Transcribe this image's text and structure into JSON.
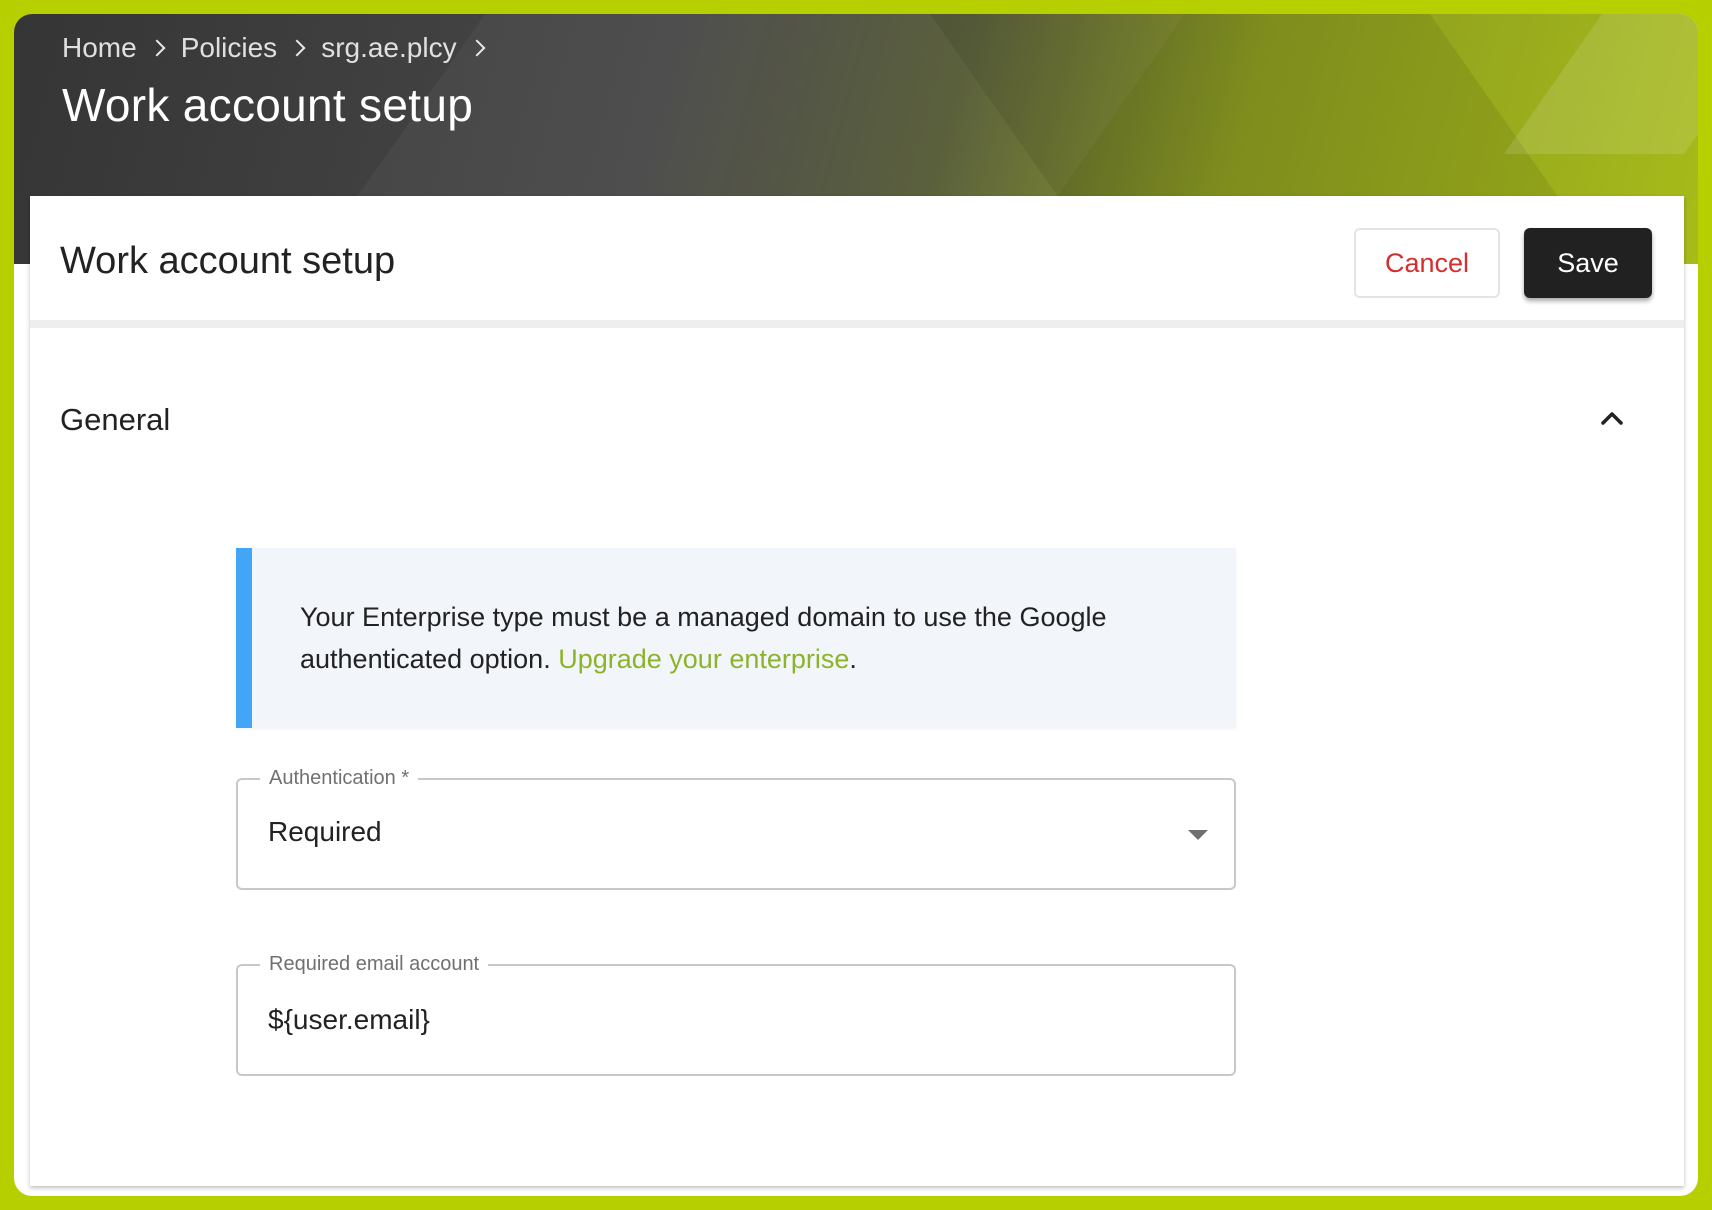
{
  "header": {
    "breadcrumb": [
      "Home",
      "Policies",
      "srg.ae.plcy"
    ],
    "title": "Work account setup"
  },
  "card": {
    "title": "Work account setup",
    "cancel_label": "Cancel",
    "save_label": "Save"
  },
  "section": {
    "title": "General",
    "expanded": true,
    "collapse_icon": "chevron-up-icon"
  },
  "notice": {
    "text": "Your Enterprise type must be a managed domain to use the Google authenticated option.",
    "link_label": "Upgrade your enterprise",
    "trailing": ".",
    "accent_color": "#42a5f5"
  },
  "authentication": {
    "label": "Authentication *",
    "value": "Required"
  },
  "email_account": {
    "label": "Required email account",
    "value": "${user.email}"
  },
  "colors": {
    "frame": "#b5cf00",
    "cancel_text": "#d32f2f",
    "save_bg": "#212121",
    "link": "#8db32b"
  }
}
